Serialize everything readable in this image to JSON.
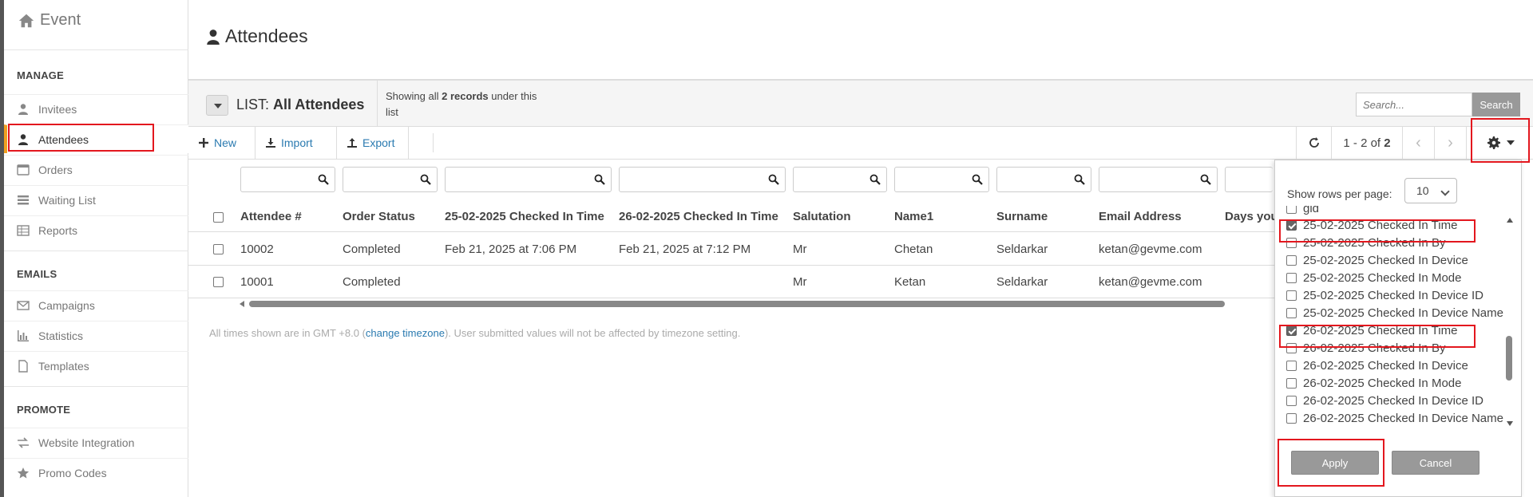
{
  "app": {
    "title": "Event"
  },
  "sidebar": {
    "sections": [
      {
        "label": "MANAGE"
      },
      {
        "label": "EMAILS"
      },
      {
        "label": "PROMOTE"
      }
    ],
    "items": [
      {
        "label": "Invitees",
        "icon": "user-icon"
      },
      {
        "label": "Attendees",
        "icon": "user-icon"
      },
      {
        "label": "Orders",
        "icon": "table-icon"
      },
      {
        "label": "Waiting List",
        "icon": "list-icon"
      },
      {
        "label": "Reports",
        "icon": "grid-icon"
      },
      {
        "label": "Campaigns",
        "icon": "envelope-icon"
      },
      {
        "label": "Statistics",
        "icon": "bar-chart-icon"
      },
      {
        "label": "Templates",
        "icon": "file-icon"
      },
      {
        "label": "Website Integration",
        "icon": "exchange-icon"
      },
      {
        "label": "Promo Codes",
        "icon": "star-icon"
      }
    ]
  },
  "page": {
    "title": "Attendees"
  },
  "list": {
    "prefix": "LIST:",
    "name": "All Attendees",
    "showing_pre": "Showing all",
    "showing_count": "2 records",
    "showing_post": "under this list"
  },
  "search": {
    "placeholder": "Search...",
    "button": "Search"
  },
  "toolbar": {
    "new_label": "New",
    "import_label": "Import",
    "export_label": "Export",
    "pager_range": "1 - 2 of",
    "pager_total": "2"
  },
  "table": {
    "columns": [
      "Attendee #",
      "Order Status",
      "25-02-2025 Checked In Time",
      "26-02-2025 Checked In Time",
      "Salutation",
      "Name1",
      "Surname",
      "Email Address",
      "Days you"
    ],
    "rows": [
      [
        "10002",
        "Completed",
        "Feb 21, 2025 at 7:06 PM",
        "Feb 21, 2025 at 7:12 PM",
        "Mr",
        "Chetan",
        "Seldarkar",
        "ketan@gevme.com"
      ],
      [
        "10001",
        "Completed",
        "",
        "",
        "Mr",
        "Ketan",
        "Seldarkar",
        "ketan@gevme.com"
      ]
    ]
  },
  "timezone_note": {
    "pre": "All times shown are in GMT +8.0 (",
    "link": "change timezone",
    "post": "). User submitted values will not be affected by timezone setting."
  },
  "column_panel": {
    "rows_label": "Show rows per page:",
    "rows_value": "10",
    "items": [
      {
        "label": "gid",
        "checked": false
      },
      {
        "label": "25-02-2025 Checked In Time",
        "checked": true
      },
      {
        "label": "25-02-2025 Checked In By",
        "checked": false
      },
      {
        "label": "25-02-2025 Checked In Device",
        "checked": false
      },
      {
        "label": "25-02-2025 Checked In Mode",
        "checked": false
      },
      {
        "label": "25-02-2025 Checked In Device ID",
        "checked": false
      },
      {
        "label": "25-02-2025 Checked In Device Name",
        "checked": false
      },
      {
        "label": "26-02-2025 Checked In Time",
        "checked": true
      },
      {
        "label": "26-02-2025 Checked In By",
        "checked": false
      },
      {
        "label": "26-02-2025 Checked In Device",
        "checked": false
      },
      {
        "label": "26-02-2025 Checked In Mode",
        "checked": false
      },
      {
        "label": "26-02-2025 Checked In Device ID",
        "checked": false
      },
      {
        "label": "26-02-2025 Checked In Device Name",
        "checked": false
      }
    ],
    "apply_label": "Apply",
    "cancel_label": "Cancel"
  },
  "colors": {
    "accent": "#f0a020",
    "link": "#2a7ab0",
    "highlight": "#e3171e",
    "button_grey": "#999999"
  }
}
